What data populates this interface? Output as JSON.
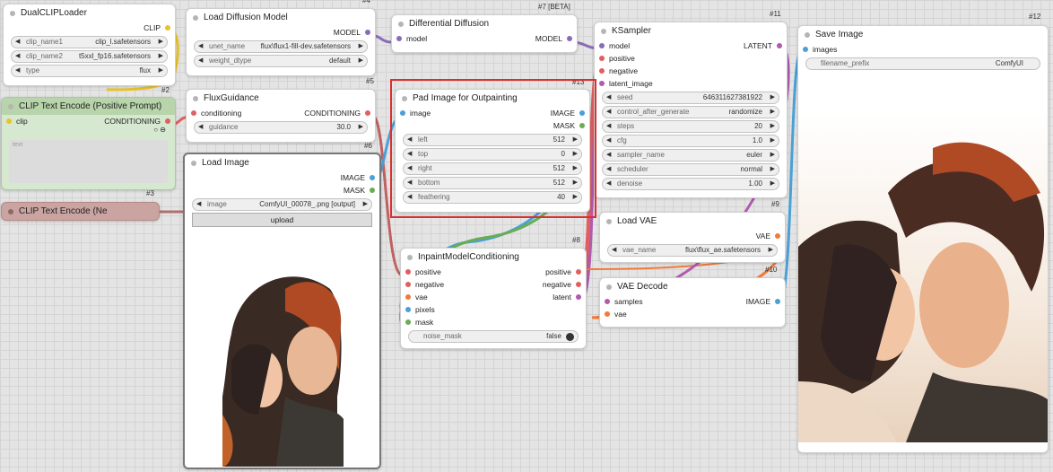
{
  "nodes": {
    "dualclip": {
      "title": "DualCLIPLoader",
      "out": "CLIP",
      "w": [
        {
          "l": "clip_name1",
          "v": "clip_l.safetensors"
        },
        {
          "l": "clip_name2",
          "v": "t5xxl_fp16.safetensors"
        },
        {
          "l": "type",
          "v": "flux"
        }
      ]
    },
    "clipPos": {
      "id": "#2",
      "title": "CLIP Text Encode (Positive Prompt)",
      "in": "clip",
      "out": "CONDITIONING",
      "text_placeholder": "text"
    },
    "clipNeg": {
      "id": "#3",
      "title": "CLIP Text Encode (Ne"
    },
    "loadDiff": {
      "id": "#4",
      "title": "Load Diffusion Model",
      "out": "MODEL",
      "w": [
        {
          "l": "unet_name",
          "v": "flux\\flux1-fill-dev.safetensors"
        },
        {
          "l": "weight_dtype",
          "v": "default"
        }
      ]
    },
    "fluxG": {
      "id": "#5",
      "title": "FluxGuidance",
      "in": "conditioning",
      "out": "CONDITIONING",
      "w": [
        {
          "l": "guidance",
          "v": "30.0"
        }
      ]
    },
    "loadImg": {
      "id": "#6",
      "title": "Load Image",
      "outs": [
        "IMAGE",
        "MASK"
      ],
      "w": [
        {
          "l": "image",
          "v": "ComfyUI_00078_.png [output]"
        }
      ],
      "button": "upload"
    },
    "diffD": {
      "id": "#7 [BETA]",
      "title": "Differential Diffusion",
      "in": "model",
      "out": "MODEL"
    },
    "pad": {
      "id": "#13",
      "title": "Pad Image for Outpainting",
      "in": "image",
      "outs": [
        "IMAGE",
        "MASK"
      ],
      "w": [
        {
          "l": "left",
          "v": "512"
        },
        {
          "l": "top",
          "v": "0"
        },
        {
          "l": "right",
          "v": "512"
        },
        {
          "l": "bottom",
          "v": "512"
        },
        {
          "l": "feathering",
          "v": "40"
        }
      ]
    },
    "inpaint": {
      "id": "#8",
      "title": "InpaintModelConditioning",
      "ins": [
        "positive",
        "negative",
        "vae",
        "pixels",
        "mask"
      ],
      "outs": [
        "positive",
        "negative",
        "latent"
      ],
      "toggle": {
        "l": "noise_mask",
        "v": "false"
      }
    },
    "ksampler": {
      "id": "#11",
      "title": "KSampler",
      "ins": [
        "model",
        "positive",
        "negative",
        "latent_image"
      ],
      "out": "LATENT",
      "w": [
        {
          "l": "seed",
          "v": "646311627381922"
        },
        {
          "l": "control_after_generate",
          "v": "randomize"
        },
        {
          "l": "steps",
          "v": "20"
        },
        {
          "l": "cfg",
          "v": "1.0"
        },
        {
          "l": "sampler_name",
          "v": "euler"
        },
        {
          "l": "scheduler",
          "v": "normal"
        },
        {
          "l": "denoise",
          "v": "1.00"
        }
      ]
    },
    "loadVae": {
      "id": "#9",
      "title": "Load VAE",
      "out": "VAE",
      "w": [
        {
          "l": "vae_name",
          "v": "flux\\flux_ae.safetensors"
        }
      ]
    },
    "vaeDec": {
      "id": "#10",
      "title": "VAE Decode",
      "ins": [
        "samples",
        "vae"
      ],
      "out": "IMAGE"
    },
    "save": {
      "id": "#12",
      "title": "Save Image",
      "in": "images",
      "w": [
        {
          "l": "filename_prefix",
          "v": "ComfyUI"
        }
      ]
    }
  },
  "colors": {
    "clip": "#e8c32a",
    "model": "#8a6bb8",
    "conditioning": "#e06060",
    "image": "#4aa0d8",
    "mask": "#6aac55",
    "vae": "#f07a3a",
    "latent": "#b05ab0",
    "highlight": "#d93030"
  }
}
